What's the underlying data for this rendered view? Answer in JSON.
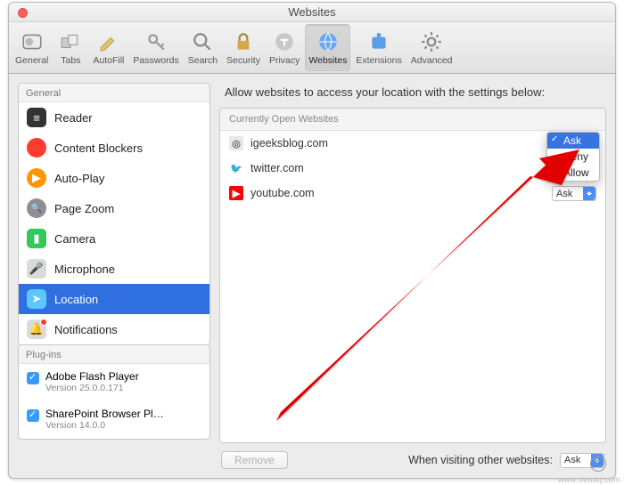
{
  "window_title": "Websites",
  "toolbar": [
    {
      "id": "general",
      "label": "General"
    },
    {
      "id": "tabs",
      "label": "Tabs"
    },
    {
      "id": "autofill",
      "label": "AutoFill"
    },
    {
      "id": "passwords",
      "label": "Passwords"
    },
    {
      "id": "search",
      "label": "Search"
    },
    {
      "id": "security",
      "label": "Security"
    },
    {
      "id": "privacy",
      "label": "Privacy"
    },
    {
      "id": "websites",
      "label": "Websites",
      "selected": true
    },
    {
      "id": "extensions",
      "label": "Extensions"
    },
    {
      "id": "advanced",
      "label": "Advanced"
    }
  ],
  "sidebar": {
    "general_header": "General",
    "items": [
      {
        "id": "reader",
        "label": "Reader",
        "color": "#333"
      },
      {
        "id": "content-blockers",
        "label": "Content Blockers",
        "color": "#ff3b30"
      },
      {
        "id": "auto-play",
        "label": "Auto-Play",
        "color": "#ff9500"
      },
      {
        "id": "page-zoom",
        "label": "Page Zoom",
        "color": "#8e8e93"
      },
      {
        "id": "camera",
        "label": "Camera",
        "color": "#34c759"
      },
      {
        "id": "microphone",
        "label": "Microphone",
        "color": "#d0d0d0"
      },
      {
        "id": "location",
        "label": "Location",
        "color": "#5ac8fa",
        "active": true
      },
      {
        "id": "notifications",
        "label": "Notifications",
        "color": "#d0d0d0",
        "badge": true
      }
    ],
    "plugins_header": "Plug-ins",
    "plugins": [
      {
        "name": "Adobe Flash Player",
        "version": "Version 25.0.0.171",
        "checked": true
      },
      {
        "name": "SharePoint Browser Pl…",
        "version": "Version 14.0.0",
        "checked": true
      }
    ]
  },
  "main": {
    "heading": "Allow websites to access your location with the settings below:",
    "section_header": "Currently Open Websites",
    "sites": [
      {
        "id": "igeeksblog",
        "label": "igeeksblog.com",
        "value": "Ask"
      },
      {
        "id": "twitter",
        "label": "twitter.com",
        "value": "Ask"
      },
      {
        "id": "youtube",
        "label": "youtube.com",
        "value": "Ask"
      }
    ],
    "dropdown": {
      "options": [
        "Ask",
        "Deny",
        "Allow"
      ],
      "selected": "Ask"
    },
    "remove_label": "Remove",
    "footer_label": "When visiting other websites:",
    "footer_value": "Ask"
  },
  "watermark": "www.deuaq.com"
}
